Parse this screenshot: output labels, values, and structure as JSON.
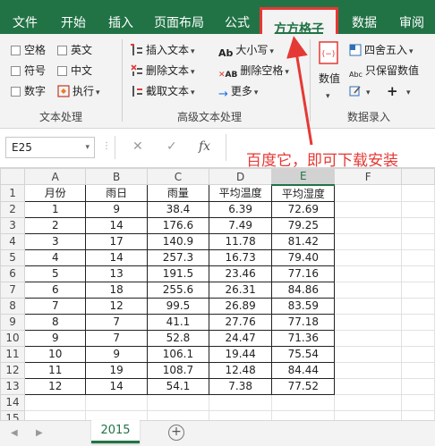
{
  "tabs": [
    "文件",
    "开始",
    "插入",
    "页面布局",
    "公式",
    "方方格子",
    "数据",
    "审阅"
  ],
  "active_tab": "方方格子",
  "ribbon": {
    "text_group": {
      "label": "文本处理",
      "checkboxes": [
        "空格",
        "英文",
        "符号",
        "中文",
        "数字"
      ],
      "execute_label": "执行"
    },
    "advanced_group": {
      "label": "高级文本处理",
      "items": [
        "插入文本",
        "删除文本",
        "截取文本",
        "大小写",
        "删除空格",
        "更多"
      ]
    },
    "data_entry_group": {
      "label": "数据录入",
      "value_label": "数值",
      "round_label": "四舍五入",
      "keep_value_label": "只保留数值"
    }
  },
  "formula_bar": {
    "name_box": "E25",
    "cancel": "✕",
    "confirm": "✓",
    "fx": "fx"
  },
  "annotation": "百度它，即可下载安装",
  "sheet": {
    "columns": [
      "A",
      "B",
      "C",
      "D",
      "E",
      "F"
    ],
    "selected_column": "E",
    "row_numbers": [
      "1",
      "2",
      "3",
      "4",
      "5",
      "6",
      "7",
      "8",
      "9",
      "10",
      "11",
      "12",
      "13",
      "14",
      "15"
    ],
    "rows": [
      [
        "月份",
        "雨日",
        "雨量",
        "平均温度",
        "平均湿度"
      ],
      [
        "1",
        "9",
        "38.4",
        "6.39",
        "72.69"
      ],
      [
        "2",
        "14",
        "176.6",
        "7.49",
        "79.25"
      ],
      [
        "3",
        "17",
        "140.9",
        "11.78",
        "81.42"
      ],
      [
        "4",
        "14",
        "257.3",
        "16.73",
        "79.40"
      ],
      [
        "5",
        "13",
        "191.5",
        "23.46",
        "77.16"
      ],
      [
        "6",
        "18",
        "255.6",
        "26.31",
        "84.86"
      ],
      [
        "7",
        "12",
        "99.5",
        "26.89",
        "83.59"
      ],
      [
        "8",
        "7",
        "41.1",
        "27.76",
        "77.18"
      ],
      [
        "9",
        "7",
        "52.8",
        "24.47",
        "71.36"
      ],
      [
        "10",
        "9",
        "106.1",
        "19.44",
        "75.54"
      ],
      [
        "11",
        "19",
        "108.7",
        "12.48",
        "84.44"
      ],
      [
        "12",
        "14",
        "54.1",
        "7.38",
        "77.52"
      ]
    ]
  },
  "sheet_tab": "2015",
  "add_sheet": "+",
  "colors": {
    "excel_green": "#217346",
    "highlight_red": "#e53935"
  }
}
